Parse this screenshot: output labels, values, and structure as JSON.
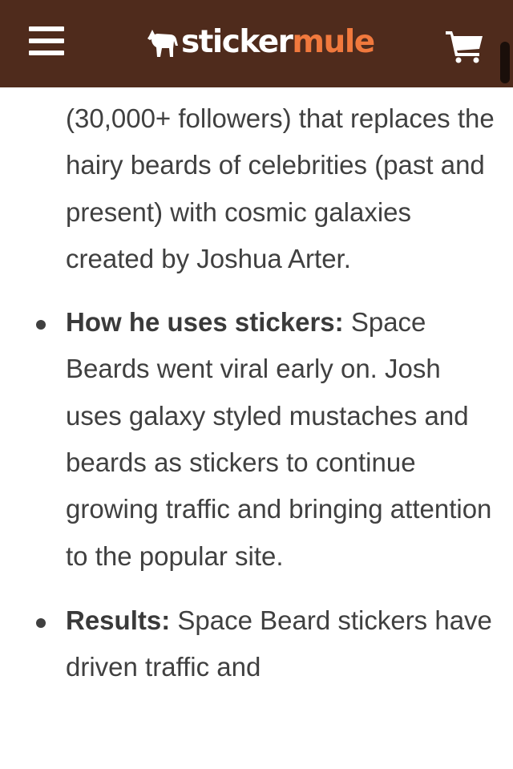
{
  "header": {
    "menu_icon": "hamburger-menu-icon",
    "logo": {
      "part1": "sticker",
      "part2": "mule",
      "icon": "mule-icon"
    },
    "cart_icon": "shopping-cart-icon",
    "colors": {
      "background": "#4f2b1c",
      "accent": "#f1793d",
      "text": "#ffffff"
    }
  },
  "article": {
    "intro_fragment": "(30,000+ followers) that replaces the hairy beards of celebrities (past and present) with cosmic galaxies created by Joshua Arter.",
    "bullets": [
      {
        "label": "How he uses stickers:",
        "text": " Space Beards went viral early on. Josh uses galaxy styled mustaches and beards as stickers to continue growing traffic and bringing attention to the popular site."
      },
      {
        "label": "Results:",
        "text": " Space Beard stickers have driven traffic and"
      }
    ]
  }
}
